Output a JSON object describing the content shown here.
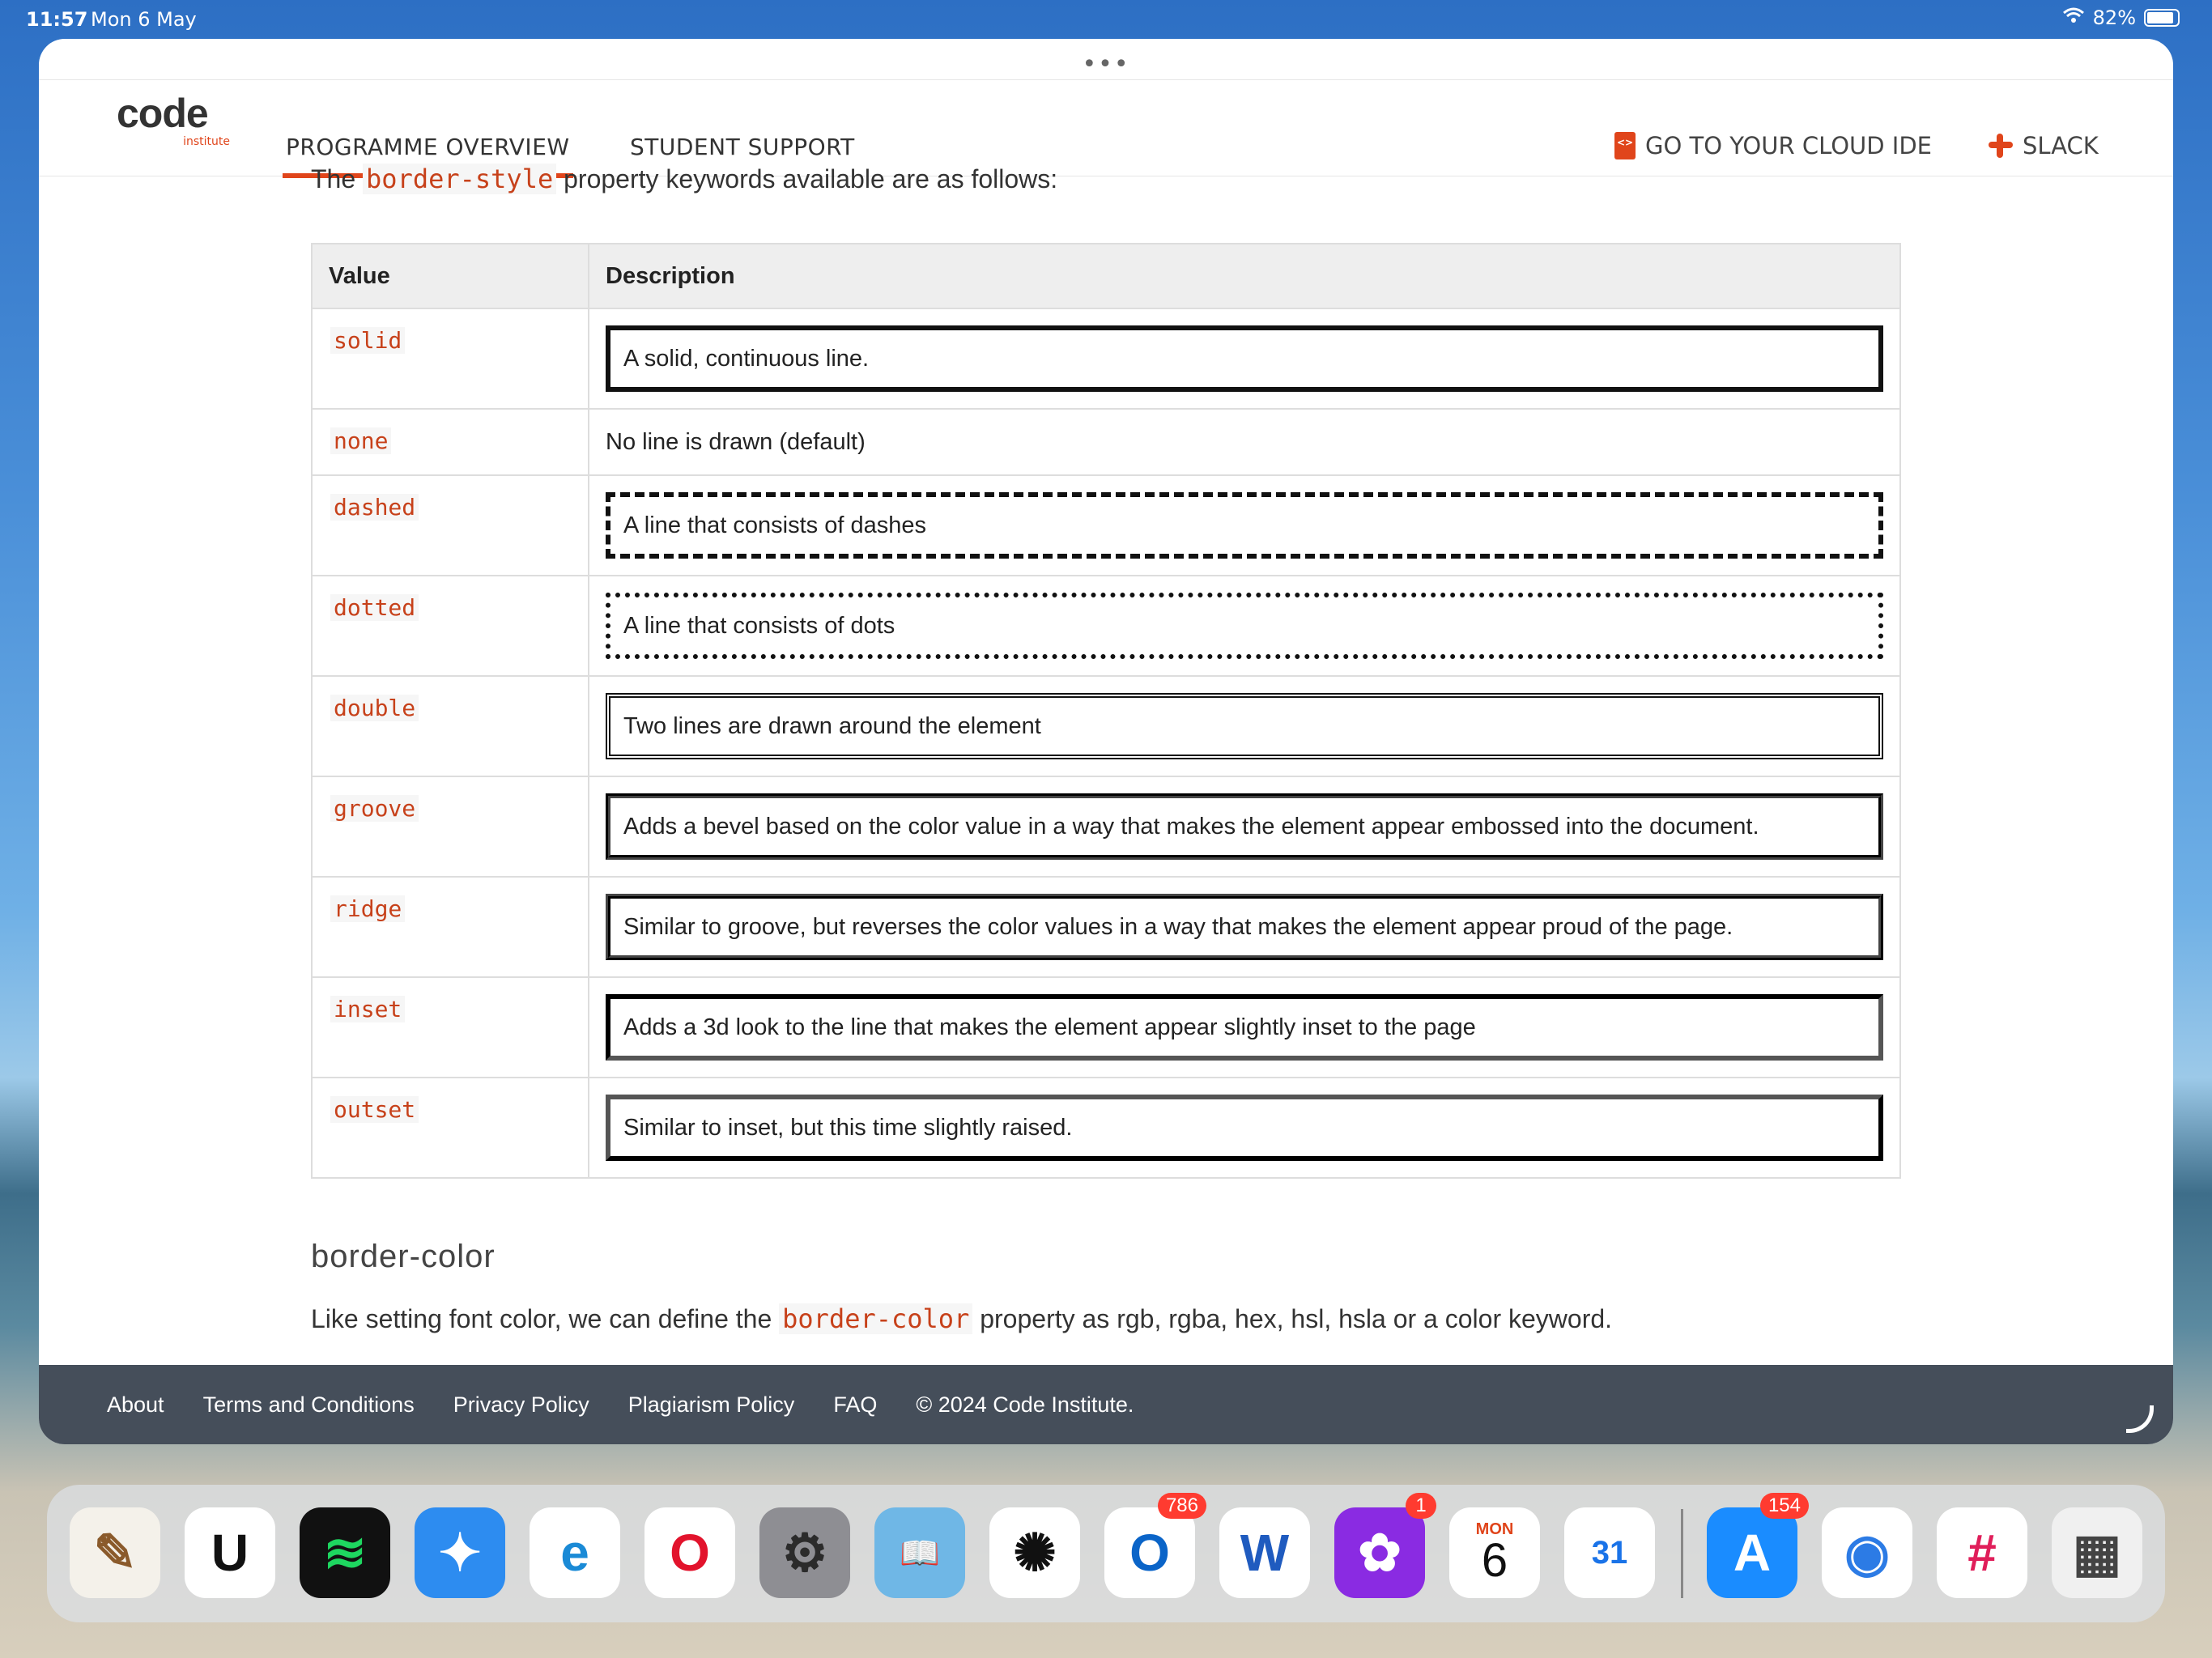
{
  "status": {
    "time": "11:57",
    "date": "Mon 6 May",
    "battery": "82%"
  },
  "nav": {
    "logo_word": "code",
    "logo_sub": "institute",
    "items": [
      "PROGRAMME OVERVIEW",
      "STUDENT SUPPORT"
    ],
    "cloud_ide": "GO TO YOUR CLOUD IDE",
    "slack": "SLACK"
  },
  "content": {
    "intro_pre": "The ",
    "intro_code": "border-style",
    "intro_post": " property keywords available are as follows:",
    "table": {
      "headers": [
        "Value",
        "Description"
      ],
      "rows": [
        {
          "value": "solid",
          "description": "A solid, continuous line."
        },
        {
          "value": "none",
          "description": "No line is drawn (default)"
        },
        {
          "value": "dashed",
          "description": "A line that consists of dashes"
        },
        {
          "value": "dotted",
          "description": "A line that consists of dots"
        },
        {
          "value": "double",
          "description": "Two lines are drawn around the element"
        },
        {
          "value": "groove",
          "description": "Adds a bevel based on the color value in a way that makes the element appear embossed into the document."
        },
        {
          "value": "ridge",
          "description": "Similar to groove, but reverses the color values in a way that makes the element appear proud of the page."
        },
        {
          "value": "inset",
          "description": "Adds a 3d look to the line that makes the element appear slightly inset to the page"
        },
        {
          "value": "outset",
          "description": "Similar to inset, but this time slightly raised."
        }
      ]
    },
    "heading": "border-color",
    "para_pre": "Like setting font color, we can define the ",
    "para_code": "border-color",
    "para_post": " property as rgb, rgba, hex, hsl, hsla or a color keyword."
  },
  "footer": {
    "links": [
      "About",
      "Terms and Conditions",
      "Privacy Policy",
      "Plagiarism Policy",
      "FAQ"
    ],
    "copyright": "© 2024 Code Institute."
  },
  "dock": {
    "apps": [
      {
        "name": "notes-app-icon",
        "glyph": "✎",
        "bg": "#f4f1ea",
        "fg": "#8a5a2b"
      },
      {
        "name": "udemy-app-icon",
        "glyph": "U",
        "bg": "#ffffff",
        "fg": "#111111"
      },
      {
        "name": "spotify-app-icon",
        "glyph": "≋",
        "bg": "#111111",
        "fg": "#1ed760"
      },
      {
        "name": "safari-app-icon",
        "glyph": "✦",
        "bg": "#2d8cf0",
        "fg": "#ffffff"
      },
      {
        "name": "edge-app-icon",
        "glyph": "e",
        "bg": "#ffffff",
        "fg": "#1a8ad6"
      },
      {
        "name": "opera-app-icon",
        "glyph": "O",
        "bg": "#ffffff",
        "fg": "#e2132c"
      },
      {
        "name": "settings-app-icon",
        "glyph": "⚙",
        "bg": "#8e8e93",
        "fg": "#2b2b2b"
      },
      {
        "name": "kindle-app-icon",
        "glyph": "📖",
        "bg": "#6fb7e6",
        "fg": "#111111"
      },
      {
        "name": "chatgpt-app-icon",
        "glyph": "✺",
        "bg": "#ffffff",
        "fg": "#111111"
      },
      {
        "name": "outlook-app-icon",
        "glyph": "O",
        "bg": "#ffffff",
        "fg": "#0a64c8",
        "badge": "786"
      },
      {
        "name": "word-app-icon",
        "glyph": "W",
        "bg": "#ffffff",
        "fg": "#1f5bbf"
      },
      {
        "name": "yapp-app-icon",
        "glyph": "✿",
        "bg": "#8a2be2",
        "fg": "#ffffff",
        "badge": "1"
      },
      {
        "name": "calendar-app-icon",
        "glyph": "6",
        "bg": "#ffffff",
        "fg": "#111111",
        "label": "MON"
      },
      {
        "name": "google-calendar-app-icon",
        "glyph": "31",
        "bg": "#ffffff",
        "fg": "#1a73e8"
      },
      {
        "name": "app-store-app-icon",
        "glyph": "A",
        "bg": "#1a8cff",
        "fg": "#ffffff",
        "badge": "154"
      },
      {
        "name": "chrome-app-icon",
        "glyph": "◉",
        "bg": "#ffffff",
        "fg": "#2c7be5"
      },
      {
        "name": "slack-app-icon",
        "glyph": "#",
        "bg": "#ffffff",
        "fg": "#e01e5a"
      },
      {
        "name": "app-library-icon",
        "glyph": "▦",
        "bg": "#f0f0f0",
        "fg": "#444444"
      }
    ]
  },
  "colors": {
    "accent": "#e0451b",
    "footer": "#454e5a"
  }
}
